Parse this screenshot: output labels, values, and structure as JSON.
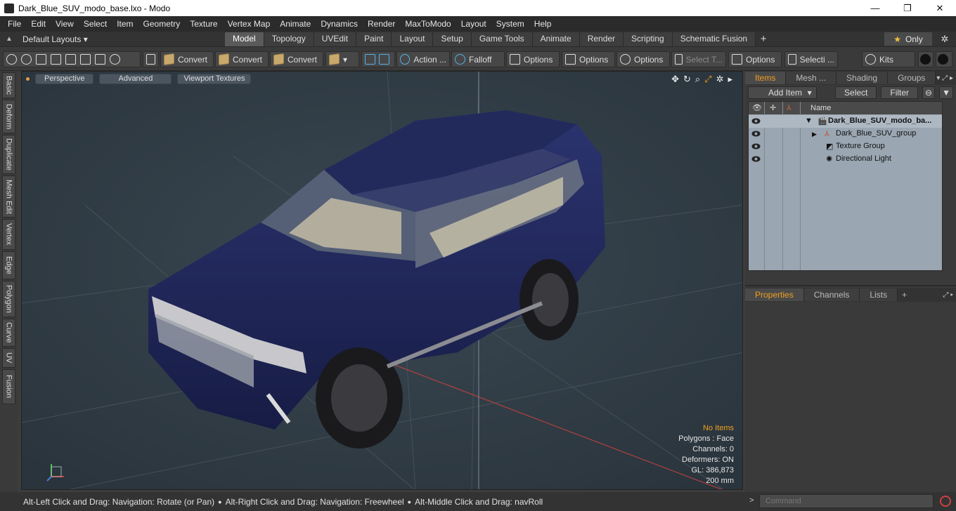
{
  "window": {
    "title": "Dark_Blue_SUV_modo_base.lxo - Modo",
    "minimize": "—",
    "maximize": "❐",
    "close": "✕"
  },
  "menu": [
    "File",
    "Edit",
    "View",
    "Select",
    "Item",
    "Geometry",
    "Texture",
    "Vertex Map",
    "Animate",
    "Dynamics",
    "Render",
    "MaxToModo",
    "Layout",
    "System",
    "Help"
  ],
  "layouts": {
    "selector": "Default Layouts ▾",
    "tabs": [
      "Model",
      "Topology",
      "UVEdit",
      "Paint",
      "Layout",
      "Setup",
      "Game Tools",
      "Animate",
      "Render",
      "Scripting",
      "Schematic Fusion"
    ],
    "active_tab": "Model",
    "add": "+",
    "only_label": "Only",
    "star": "★",
    "gear": "✲"
  },
  "toolbar": {
    "convert1": "Convert",
    "convert2": "Convert",
    "convert3": "Convert",
    "action": "Action ...",
    "falloff": "Falloff",
    "options1": "Options",
    "options2": "Options",
    "options3": "Options",
    "select_t": "Select T...",
    "options4": "Options",
    "selecti": "Selecti ...",
    "kits": "Kits",
    "dropdown": "▾"
  },
  "left_tabs": [
    "Basic",
    "Deform",
    "Duplicate",
    "Mesh Edit",
    "Vertex",
    "Edge",
    "Polygon",
    "Curve",
    "UV",
    "Fusion"
  ],
  "viewport": {
    "perspective": "Perspective",
    "advanced": "Advanced",
    "textures": "Viewport Textures",
    "icons": {
      "move": "✥",
      "rotate": "↻",
      "zoom": "⌕",
      "fit": "⤢",
      "gear": "✲",
      "more": "▸"
    },
    "stats": {
      "items": "No Items",
      "polygons": "Polygons : Face",
      "channels": "Channels: 0",
      "deformers": "Deformers: ON",
      "gl": "GL: 386,873",
      "scale": "200 mm"
    },
    "axis": {
      "y": "y",
      "x": "x",
      "z": "z"
    }
  },
  "status": {
    "hint1": "Alt-Left Click and Drag: Navigation: Rotate (or Pan)",
    "hint2": "Alt-Right Click and Drag: Navigation: Freewheel",
    "hint3": "Alt-Middle Click and Drag: navRoll",
    "bullet": "●"
  },
  "command": {
    "prompt": ">",
    "placeholder": "Command"
  },
  "items_panel": {
    "tabs": [
      "Items",
      "Mesh ...",
      "Shading",
      "Groups"
    ],
    "extra": "▾ ⤢ ▸",
    "add_item": "Add Item",
    "add_arrow": "▾",
    "select": "Select",
    "filter": "Filter",
    "col_name": "Name",
    "rows": [
      {
        "label": "Dark_Blue_SUV_modo_ba...",
        "expand": "▼"
      },
      {
        "label": "Dark_Blue_SUV_group",
        "expand": "▶"
      },
      {
        "label": "Texture Group",
        "expand": ""
      },
      {
        "label": "Directional Light",
        "expand": ""
      }
    ]
  },
  "props_panel": {
    "tabs": [
      "Properties",
      "Channels",
      "Lists"
    ],
    "add": "+",
    "extra": "⤢ ▸"
  },
  "colors": {
    "viewport_bg": "#2f3b45",
    "accent": "#f0a020",
    "car_body": "#1e2454"
  }
}
